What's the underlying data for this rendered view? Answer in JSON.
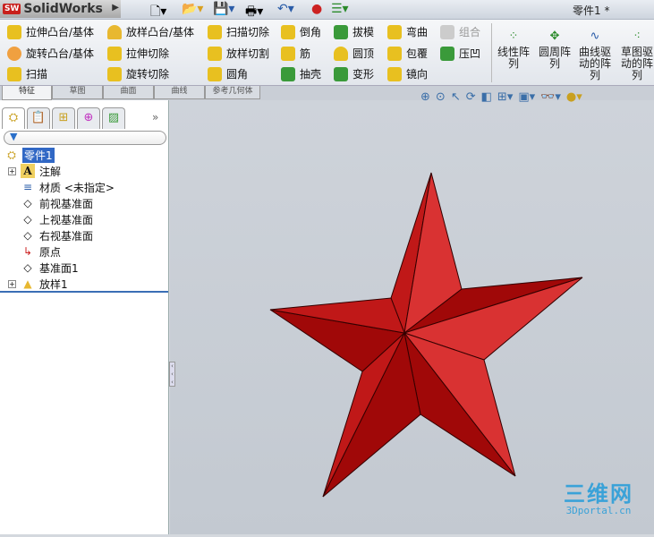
{
  "titlebar": {
    "app": "SolidWorks",
    "logo": "SW",
    "doc_title": "零件1 *",
    "quick_icons": [
      "new-icon",
      "open-icon",
      "save-icon",
      "print-icon",
      "undo-icon",
      "rebuild-icon",
      "options-icon"
    ]
  },
  "ribbon": {
    "col1": [
      "拉伸凸台/基体",
      "旋转凸台/基体",
      "扫描"
    ],
    "col2": [
      "放样凸台/基体",
      "拉伸切除",
      "旋转切除"
    ],
    "col3": [
      "扫描切除",
      "放样切割",
      "圆角"
    ],
    "col4": [
      "倒角",
      "筋",
      "抽壳"
    ],
    "col5": [
      "拔模",
      "圆顶",
      "变形"
    ],
    "col6": [
      "弯曲",
      "包覆",
      "镜向"
    ],
    "col7": [
      "组合",
      "压凹"
    ],
    "big": [
      "线性阵列",
      "圆周阵列",
      "曲线驱动的阵列",
      "草图驱动的阵列"
    ]
  },
  "tabs": [
    "特征",
    "草图",
    "曲面",
    "曲线",
    "参考几何体"
  ],
  "tree": {
    "root": "零件1",
    "items": [
      {
        "label": "注解",
        "expand": "+",
        "icon": "A"
      },
      {
        "label": "材质 <未指定>",
        "icon": "≡"
      },
      {
        "label": "前视基准面",
        "icon": "◇"
      },
      {
        "label": "上视基准面",
        "icon": "◇"
      },
      {
        "label": "右视基准面",
        "icon": "◇"
      },
      {
        "label": "原点",
        "icon": "↳"
      },
      {
        "label": "基准面1",
        "icon": "◇"
      },
      {
        "label": "放样1",
        "expand": "+",
        "icon": "▲"
      }
    ]
  },
  "watermark": {
    "line1": "三维网",
    "line2": "3Dportal.cn"
  },
  "colors": {
    "star_light": "#d93232",
    "star_mid": "#c01818",
    "star_dark": "#a00808",
    "selection": "#3168c5"
  }
}
